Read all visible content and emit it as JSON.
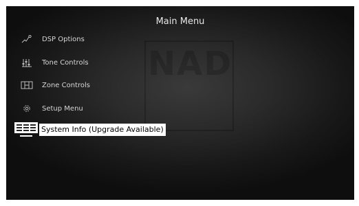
{
  "screen": {
    "title": "Main Menu",
    "watermark": "NAD"
  },
  "menu": {
    "items": [
      {
        "label": "DSP Options",
        "icon": "dsp-options-icon",
        "selected": false
      },
      {
        "label": "Tone Controls",
        "icon": "tone-controls-icon",
        "selected": false
      },
      {
        "label": "Zone Controls",
        "icon": "zone-controls-icon",
        "selected": false
      },
      {
        "label": "Setup Menu",
        "icon": "setup-gear-icon",
        "selected": false
      },
      {
        "label": "System Info (Upgrade Available)",
        "icon": "system-info-icon",
        "selected": true
      }
    ]
  },
  "colors": {
    "background": "#1e1e1e",
    "text": "#d6d6d6",
    "highlight_bg": "#ffffff",
    "highlight_text": "#000000"
  }
}
